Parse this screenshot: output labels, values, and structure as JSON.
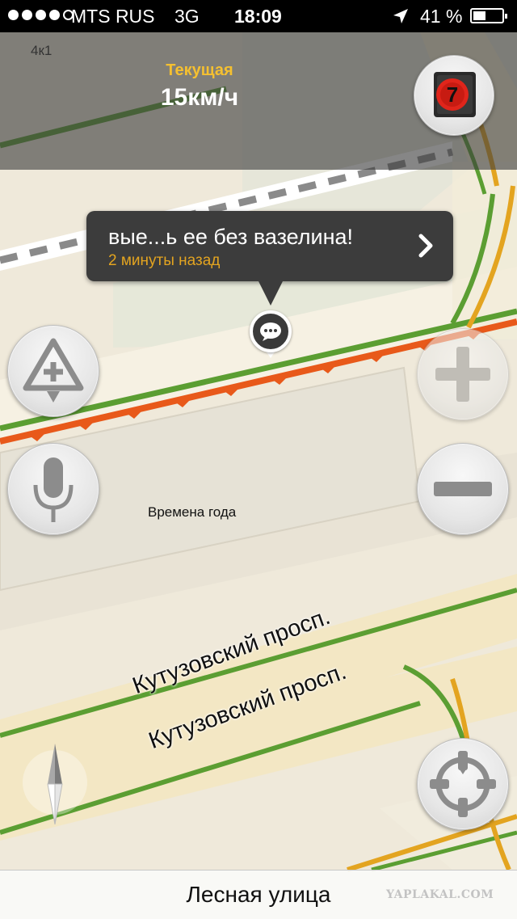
{
  "status_bar": {
    "carrier": "MTS RUS",
    "network": "3G",
    "time": "18:09",
    "battery": "41 %",
    "signal_bars_filled": 4,
    "signal_bars_total": 5,
    "location_icon": "location-arrow-icon",
    "battery_icon": "battery-icon"
  },
  "speed": {
    "label": "Текущая",
    "value": "15км/ч"
  },
  "traffic": {
    "level": "7",
    "icon": "traffic-light-icon"
  },
  "message": {
    "text": "вые...ь ее без вазелина!",
    "time_ago": "2 минуты назад",
    "icon": "chevron-right-icon",
    "pin_icon": "chat-bubble-icon"
  },
  "map": {
    "place_label": "Времена года",
    "building_label": "4к1",
    "street_labels": [
      "Кутузовский просп.",
      "Кутузовский просп."
    ],
    "colors": {
      "background": "#efe9da",
      "traffic_jam": "#e8591a",
      "traffic_free": "#5b9e32",
      "traffic_slow": "#e3a420"
    }
  },
  "controls": {
    "add_event_icon": "warning-plus-icon",
    "voice_icon": "microphone-icon",
    "zoom_in_icon": "plus-icon",
    "zoom_out_icon": "minus-icon",
    "compass_icon": "compass-icon",
    "locate_icon": "crosshair-icon"
  },
  "bottom_bar": {
    "street_name": "Лесная улица",
    "watermark": "YAPLAKAL.COM"
  }
}
